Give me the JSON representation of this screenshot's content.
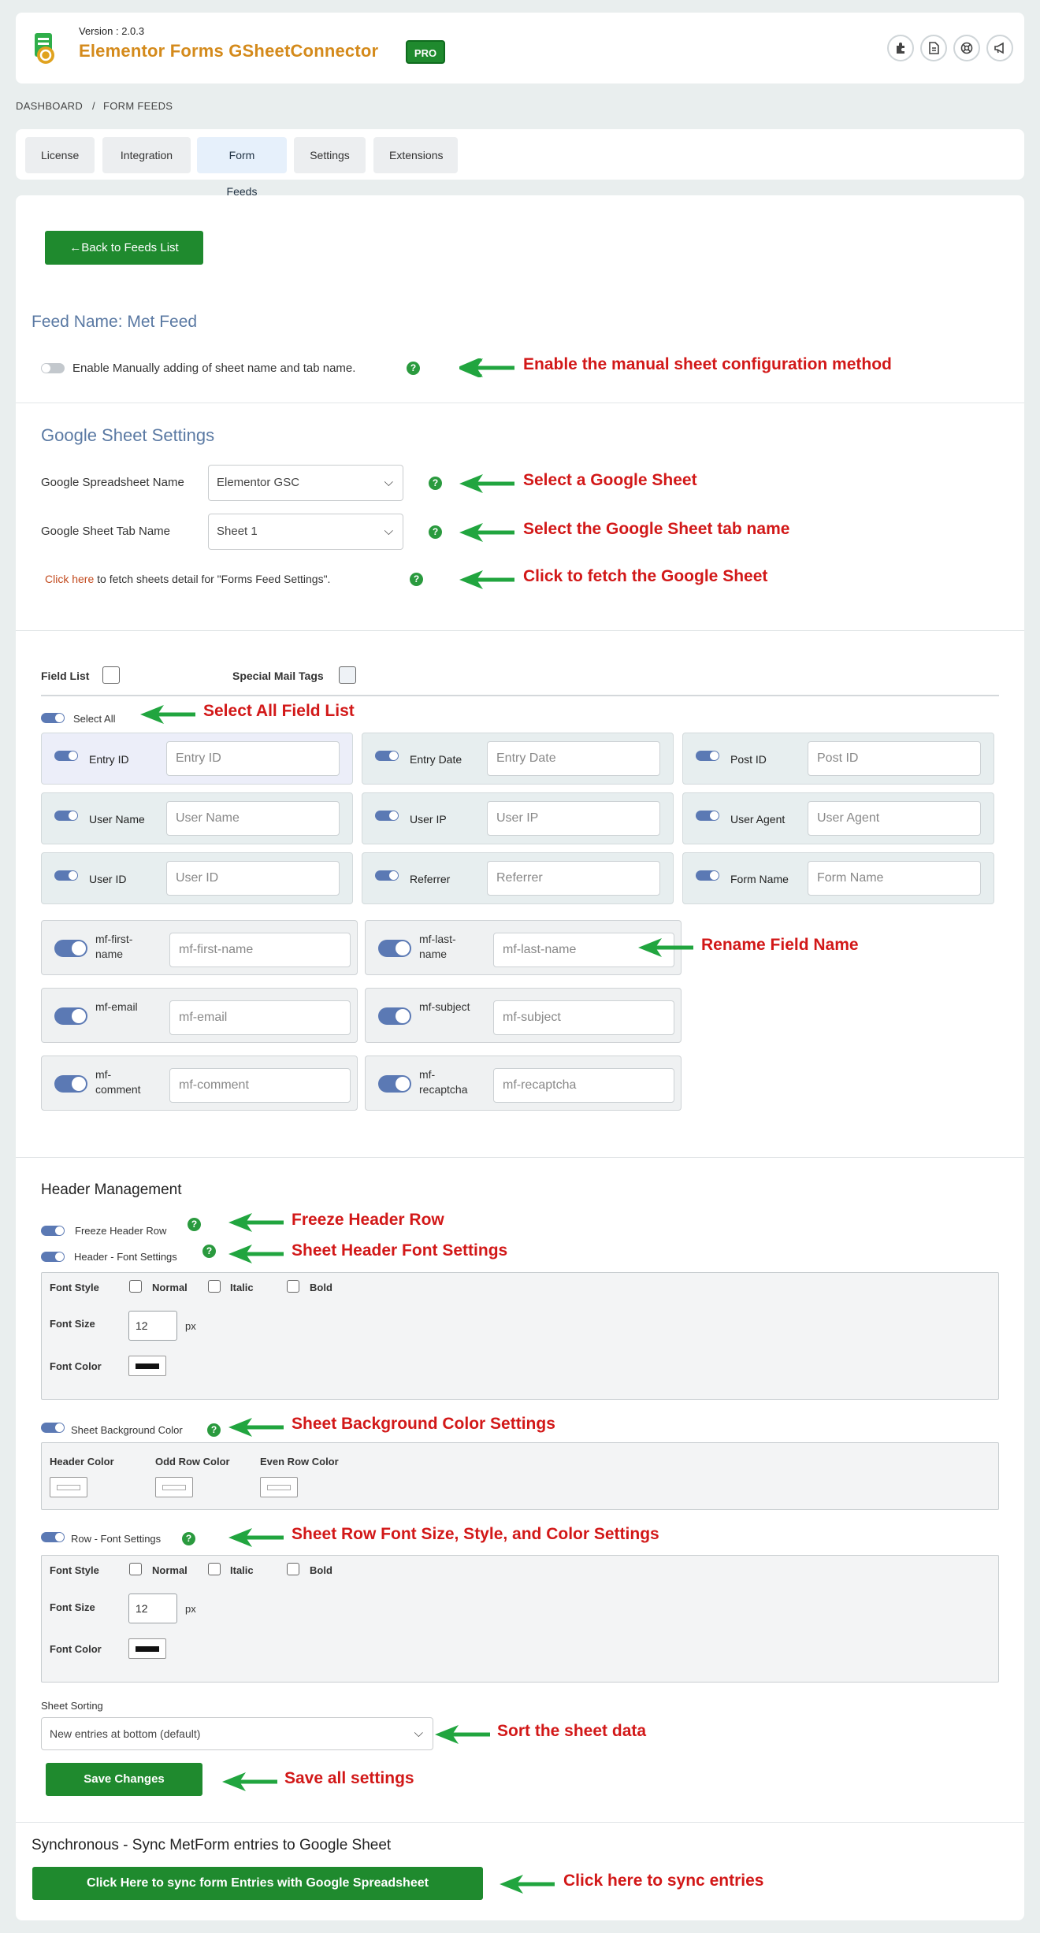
{
  "header": {
    "version": "Version : 2.0.3",
    "brand": "Elementor Forms GSheetConnector",
    "badge": "PRO",
    "icons": [
      "puzzle-icon",
      "document-icon",
      "lifebuoy-icon",
      "megaphone-icon"
    ]
  },
  "breadcrumb": {
    "dashboard": "DASHBOARD",
    "sep": "/",
    "current": "FORM FEEDS"
  },
  "tabs": [
    "License",
    "Integration",
    "Form Feeds",
    "Settings",
    "Extensions"
  ],
  "back_button": "←Back to Feeds List",
  "feed_name": "Feed Name: Met Feed",
  "manual_toggle_label": "Enable Manually adding of sheet name and tab name.",
  "google_settings": {
    "title": "Google Sheet Settings",
    "spreadsheet_label": "Google Spreadsheet Name",
    "spreadsheet_value": "Elementor GSC",
    "tab_label": "Google Sheet Tab Name",
    "tab_value": "Sheet 1",
    "fetch_link": "Click here",
    "fetch_text": " to fetch sheets detail for \"Forms Feed Settings\"."
  },
  "fields": {
    "field_list_label": "Field List",
    "mail_tags_label": "Special Mail Tags",
    "select_all": "Select All",
    "system_fields": [
      {
        "label": "Entry ID",
        "placeholder": "Entry ID"
      },
      {
        "label": "Entry Date",
        "placeholder": "Entry Date"
      },
      {
        "label": "Post ID",
        "placeholder": "Post ID"
      },
      {
        "label": "User Name",
        "placeholder": "User Name"
      },
      {
        "label": "User IP",
        "placeholder": "User IP"
      },
      {
        "label": "User Agent",
        "placeholder": "User Agent"
      },
      {
        "label": "User ID",
        "placeholder": "User ID"
      },
      {
        "label": "Referrer",
        "placeholder": "Referrer"
      },
      {
        "label": "Form Name",
        "placeholder": "Form Name"
      }
    ],
    "form_fields": [
      {
        "label": "mf-first-name",
        "placeholder": "mf-first-name"
      },
      {
        "label": "mf-last-name",
        "placeholder": "mf-last-name"
      },
      {
        "label": "mf-email",
        "placeholder": "mf-email"
      },
      {
        "label": "mf-subject",
        "placeholder": "mf-subject"
      },
      {
        "label": "mf-comment",
        "placeholder": "mf-comment"
      },
      {
        "label": "mf-recaptcha",
        "placeholder": "mf-recaptcha"
      }
    ]
  },
  "header_mgmt": {
    "title": "Header Management",
    "freeze": "Freeze Header Row",
    "font_settings": "Header - Font Settings",
    "font_style": "Font Style",
    "normal": "Normal",
    "italic": "Italic",
    "bold": "Bold",
    "font_size": "Font Size",
    "font_size_value": "12",
    "px": "px",
    "font_color": "Font Color",
    "bg_color_label": "Sheet Background Color",
    "header_color": "Header Color",
    "odd_row_color": "Odd Row Color",
    "even_row_color": "Even Row Color",
    "row_font_settings": "Row - Font Settings",
    "row_font_size_value": "12",
    "sorting_label": "Sheet Sorting",
    "sorting_value": "New entries at bottom (default)",
    "save": "Save Changes"
  },
  "sync": {
    "title": "Synchronous - Sync MetForm entries to Google Sheet",
    "button": "Click Here to sync form Entries with Google Spreadsheet"
  },
  "annotations": {
    "manual": "Enable the manual sheet configuration method",
    "select_sheet": "Select a Google Sheet",
    "select_tab": "Select the Google Sheet tab name",
    "fetch": "Click to fetch the Google Sheet",
    "select_all": "Select All Field List",
    "rename": "Rename Field Name",
    "freeze": "Freeze Header Row",
    "header_font": "Sheet Header Font Settings",
    "bg_color": "Sheet Background Color Settings",
    "row_font": "Sheet Row Font Size, Style, and Color Settings",
    "sort": "Sort the sheet data",
    "save": "Save all settings",
    "sync": "Click here to sync entries"
  },
  "colors": {
    "accent_green": "#1f8a2e",
    "annotation_red": "#d21818",
    "toggle_blue": "#5b79b4",
    "brand_orange": "#d48a1b"
  }
}
